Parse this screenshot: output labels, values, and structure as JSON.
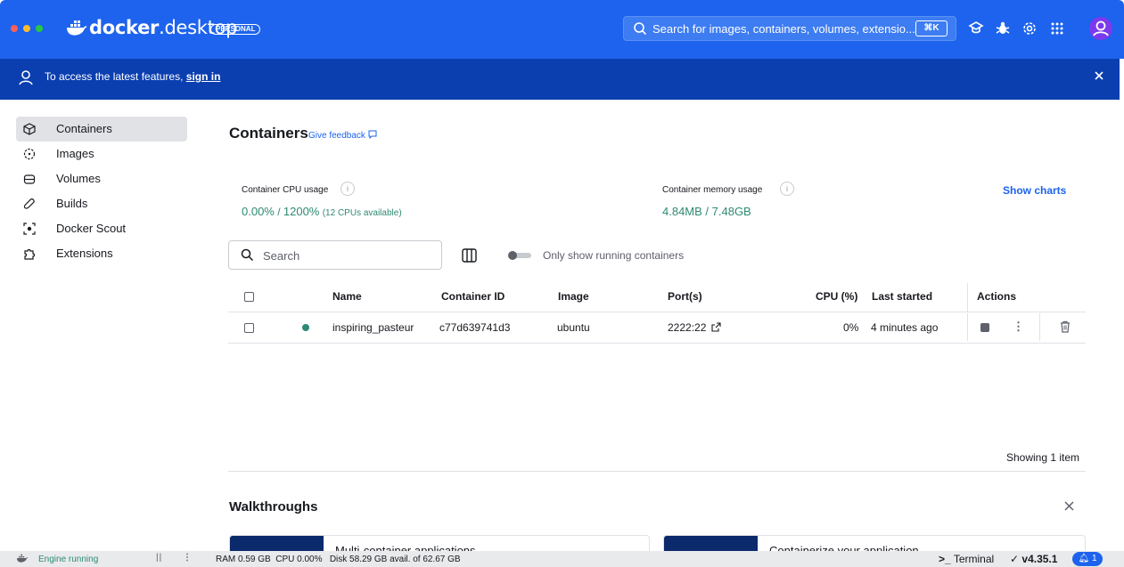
{
  "titlebar": {
    "brand_docker": "docker",
    "brand_desktop": "desktop",
    "badge": "PERSONAL",
    "search_placeholder": "Search for images, containers, volumes, extensio...",
    "search_shortcut": "⌘K",
    "icons": [
      "learning-center-icon",
      "troubleshoot-icon",
      "settings-icon",
      "extensions-grid-icon",
      "account-icon"
    ],
    "accent_color": "#1d63ed"
  },
  "banner": {
    "text": "To access the latest features,",
    "link": "sign in"
  },
  "sidebar": {
    "items": [
      {
        "label": "Containers",
        "icon": "container-icon",
        "active": true
      },
      {
        "label": "Images",
        "icon": "image-icon",
        "active": false
      },
      {
        "label": "Volumes",
        "icon": "volume-icon",
        "active": false
      },
      {
        "label": "Builds",
        "icon": "build-icon",
        "active": false
      },
      {
        "label": "Docker Scout",
        "icon": "scout-icon",
        "active": false
      },
      {
        "label": "Extensions",
        "icon": "extensions-icon",
        "active": false
      }
    ]
  },
  "main": {
    "title": "Containers",
    "feedback": "Give feedback",
    "cpu_label": "Container CPU usage",
    "cpu_used": "0.00%",
    "cpu_sep": " / ",
    "cpu_total": "1200%",
    "cpu_note": "(12 CPUs available)",
    "mem_label": "Container memory usage",
    "mem_value": "4.84MB / 7.48GB",
    "show_charts": "Show charts",
    "search_placeholder": "Search",
    "toggle_label": "Only show running containers",
    "table": {
      "headers": [
        "Name",
        "Container ID",
        "Image",
        "Port(s)",
        "CPU (%)",
        "Last started",
        "Actions"
      ],
      "rows": [
        {
          "name": "inspiring_pasteur",
          "id": "c77d639741d3",
          "image": "ubuntu",
          "ports": "2222:22",
          "cpu": "0%",
          "last_started": "4 minutes ago",
          "status": "running"
        }
      ]
    },
    "showing": "Showing 1 item",
    "walkthroughs": {
      "title": "Walkthroughs",
      "cards": [
        "Multi-container applications",
        "Containerize your application"
      ]
    }
  },
  "footer": {
    "engine": "Engine running",
    "stats": "RAM 0.59 GB  CPU 0.00%   Disk 58.29 GB avail. of 62.67 GB",
    "terminal": "Terminal",
    "version": "v4.35.1",
    "notifications": "1"
  }
}
